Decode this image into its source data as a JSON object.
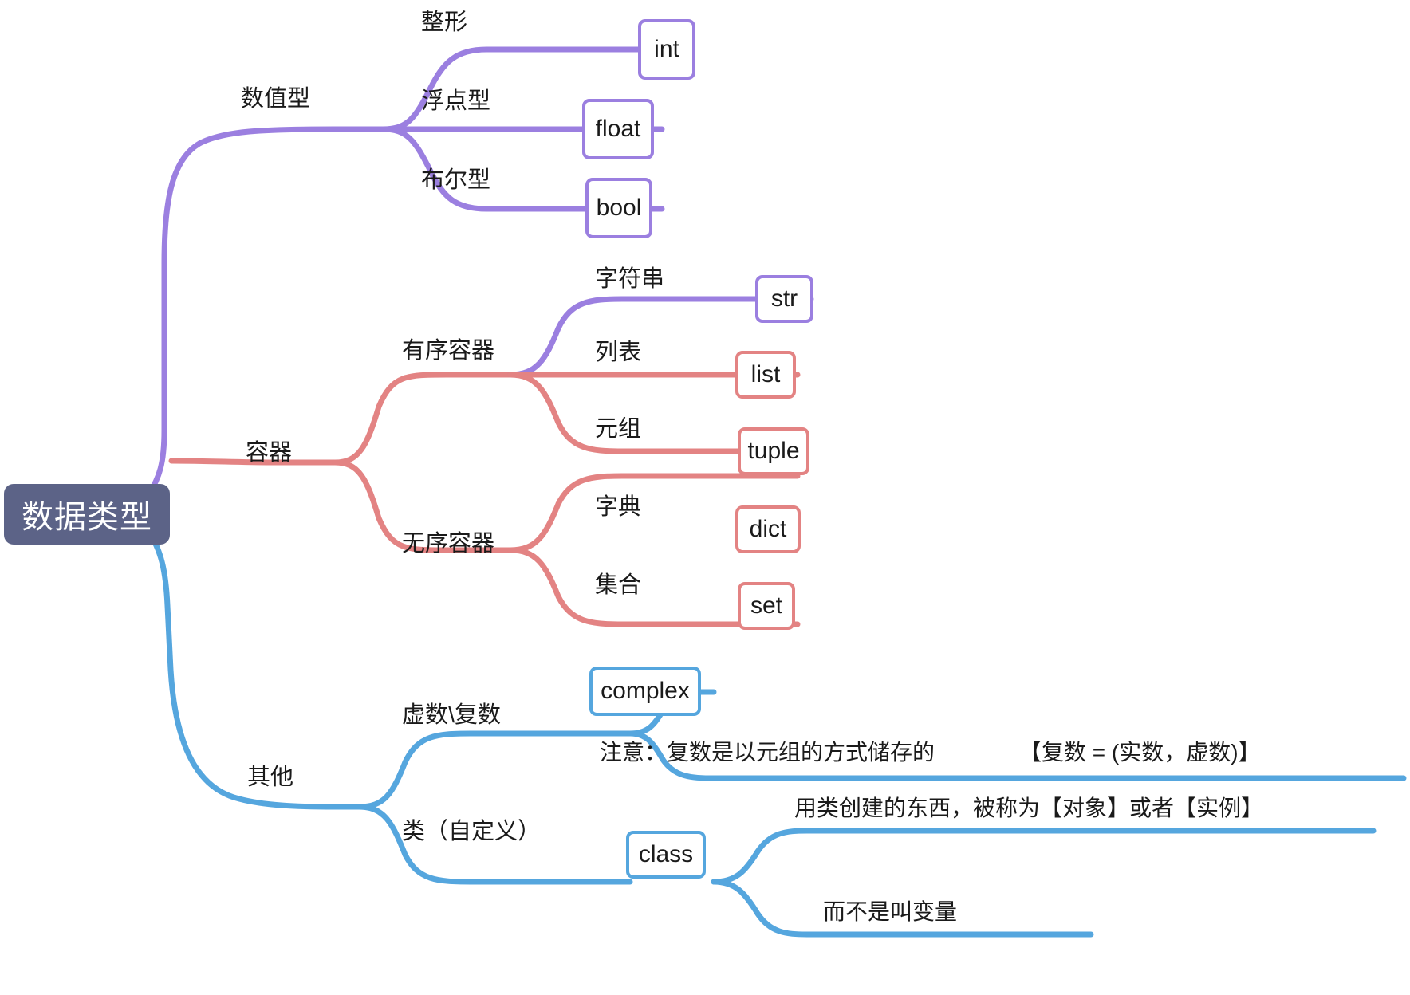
{
  "diagram": {
    "title": "数据类型",
    "type": "mindmap",
    "colors": {
      "root_fill": "#5c6387",
      "root_text": "#ffffff",
      "numeric_branch": "#9b7fe0",
      "container_branch": "#e38383",
      "other_branch": "#55a6de",
      "text": "#1a1a1a",
      "background": "#ffffff"
    }
  },
  "root": {
    "label": "数据类型"
  },
  "branches": {
    "numeric": {
      "label": "数值型",
      "color": "#9b7fe0",
      "children": [
        {
          "label": "整形",
          "box": "int"
        },
        {
          "label": "浮点型",
          "box": "float"
        },
        {
          "label": "布尔型",
          "box": "bool"
        }
      ]
    },
    "container": {
      "label": "容器",
      "color": "#e38383",
      "groups": [
        {
          "label": "有序容器",
          "children": [
            {
              "label": "字符串",
              "box": "str",
              "color": "#9b7fe0"
            },
            {
              "label": "列表",
              "box": "list",
              "color": "#e38383"
            },
            {
              "label": "元组",
              "box": "tuple",
              "color": "#e38383"
            }
          ]
        },
        {
          "label": "无序容器",
          "children": [
            {
              "label": "字典",
              "box": "dict",
              "color": "#e38383"
            },
            {
              "label": "集合",
              "box": "set",
              "color": "#e38383"
            }
          ]
        }
      ]
    },
    "other": {
      "label": "其他",
      "color": "#55a6de",
      "groups": [
        {
          "label": "虚数\\复数",
          "box": "complex",
          "notes": [
            "注意：复数是以元组的方式储存的",
            "【复数 = (实数，虚数)】"
          ]
        },
        {
          "label": "类（自定义）",
          "box": "class",
          "notes": [
            "用类创建的东西，被称为【对象】或者【实例】",
            "而不是叫变量"
          ]
        }
      ]
    }
  }
}
